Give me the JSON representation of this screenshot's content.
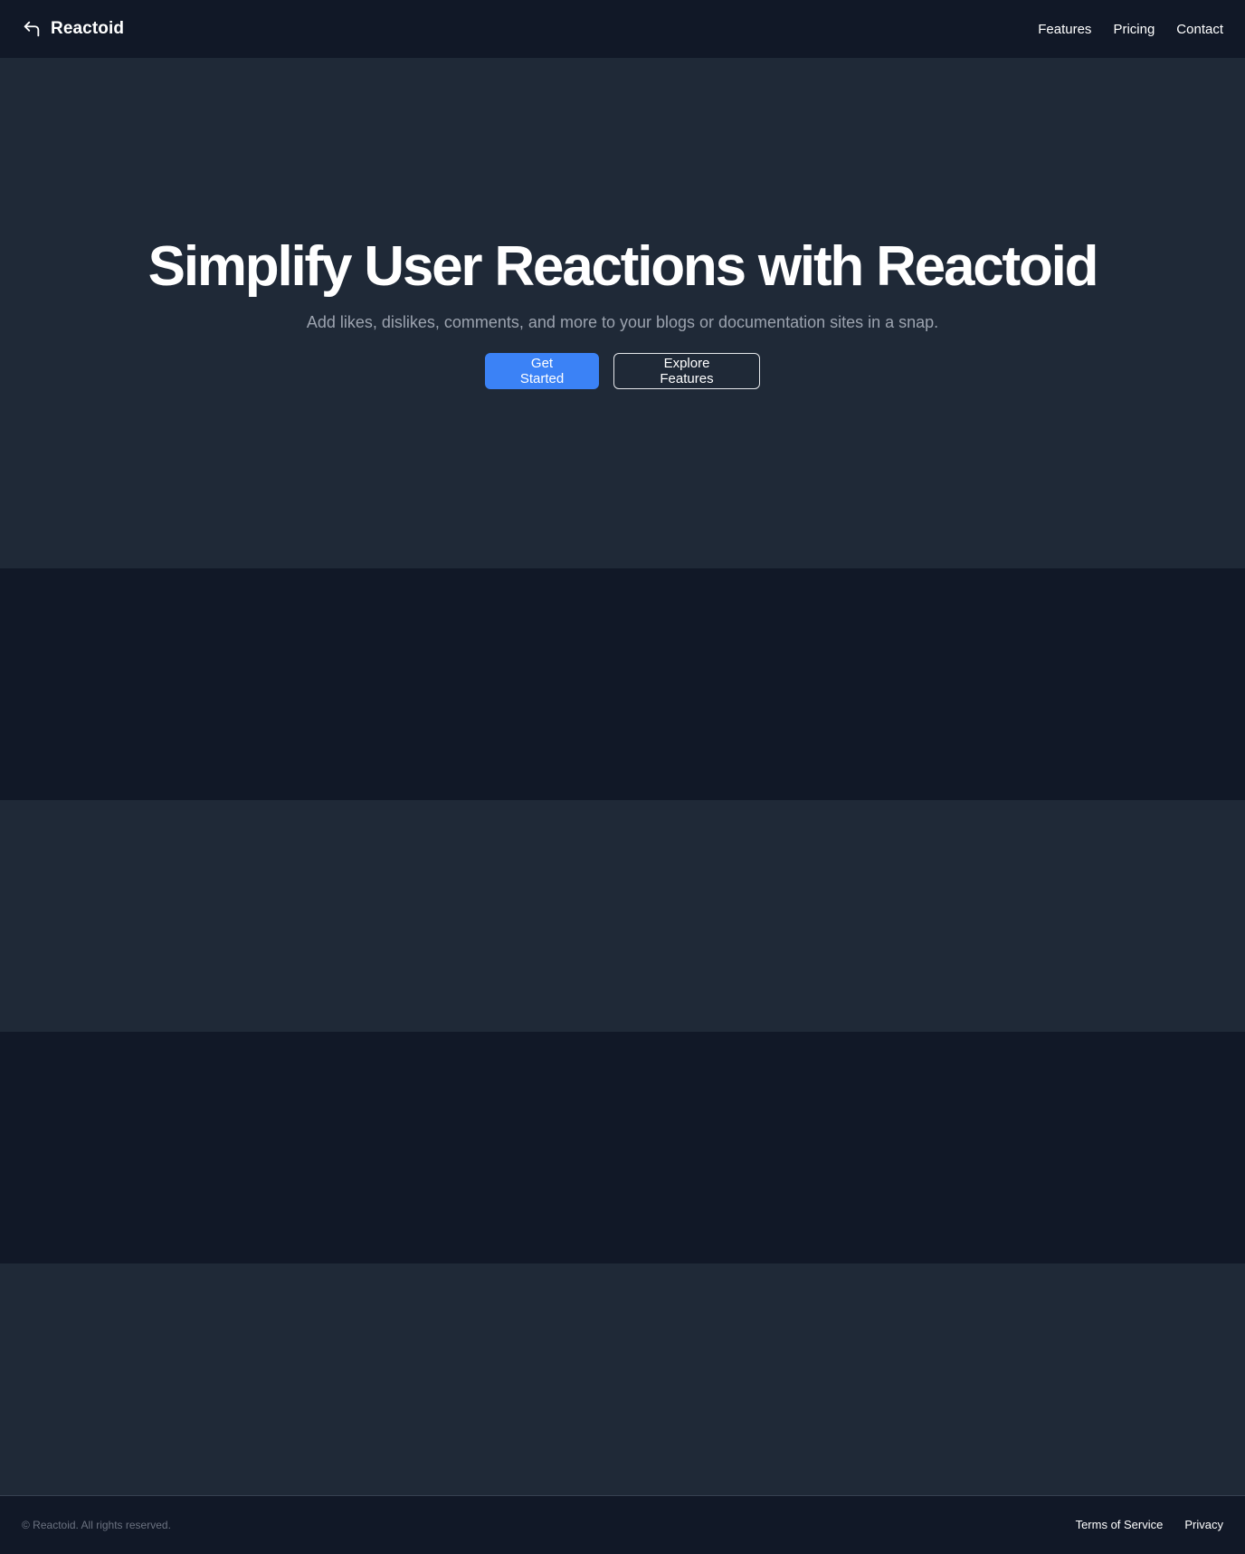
{
  "header": {
    "brand_name": "Reactoid",
    "brand_icon": "reply-arrow-icon",
    "nav": [
      {
        "label": "Features"
      },
      {
        "label": "Pricing"
      },
      {
        "label": "Contact"
      }
    ]
  },
  "hero": {
    "title": "Simplify User Reactions with Reactoid",
    "subtitle": "Add likes, dislikes, comments, and more to your blogs or documentation sites in a snap.",
    "primary_cta": "Get Started",
    "secondary_cta": "Explore Features"
  },
  "footer": {
    "copyright": "© Reactoid. All rights reserved.",
    "links": [
      {
        "label": "Terms of Service"
      },
      {
        "label": "Privacy"
      }
    ]
  },
  "colors": {
    "page_dark": "#111827",
    "section_mid": "#1f2937",
    "accent": "#3b82f6",
    "muted_text": "#9ca3af"
  }
}
